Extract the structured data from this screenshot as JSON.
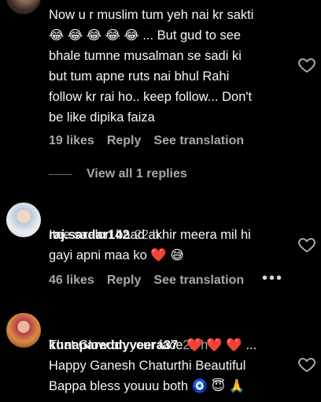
{
  "comments": [
    {
      "username": "",
      "time": "",
      "text": "Now u r muslim tum yeh nai kr sakti\n😂 😂 😂 😂 😂  ... But gud to see\nbhale tumne musalman se sadi ki\nbut tum apne ruts nai bhul Rahi\nfollow kr rai ho.. keep follow... Don't\nbe like dipika faiza",
      "likes": "19 likes",
      "reply": "Reply",
      "see_translation": "See translation",
      "view_replies": "View all 1 replies"
    },
    {
      "username": "raj.sardar142",
      "time": "22 h",
      "text": "Itne saalon baad akhir meera mil hi\ngayi apni maa ko ❤️ 😅",
      "likes": "46 likes",
      "reply": "Reply",
      "see_translation": "See translation",
      "more": "•••"
    },
    {
      "username": "kunapareddyveera37",
      "time": "22 h",
      "text": "That Glow on your face  ❤️ ❤️ ❤️ ...\nHappy Ganesh Chaturthi Beautiful\nBappa bless youuu both 🧿 😇 🙏"
    }
  ],
  "colors": {
    "background": "#000000",
    "text": "#f5f5f5",
    "muted": "#a8a8a8"
  }
}
